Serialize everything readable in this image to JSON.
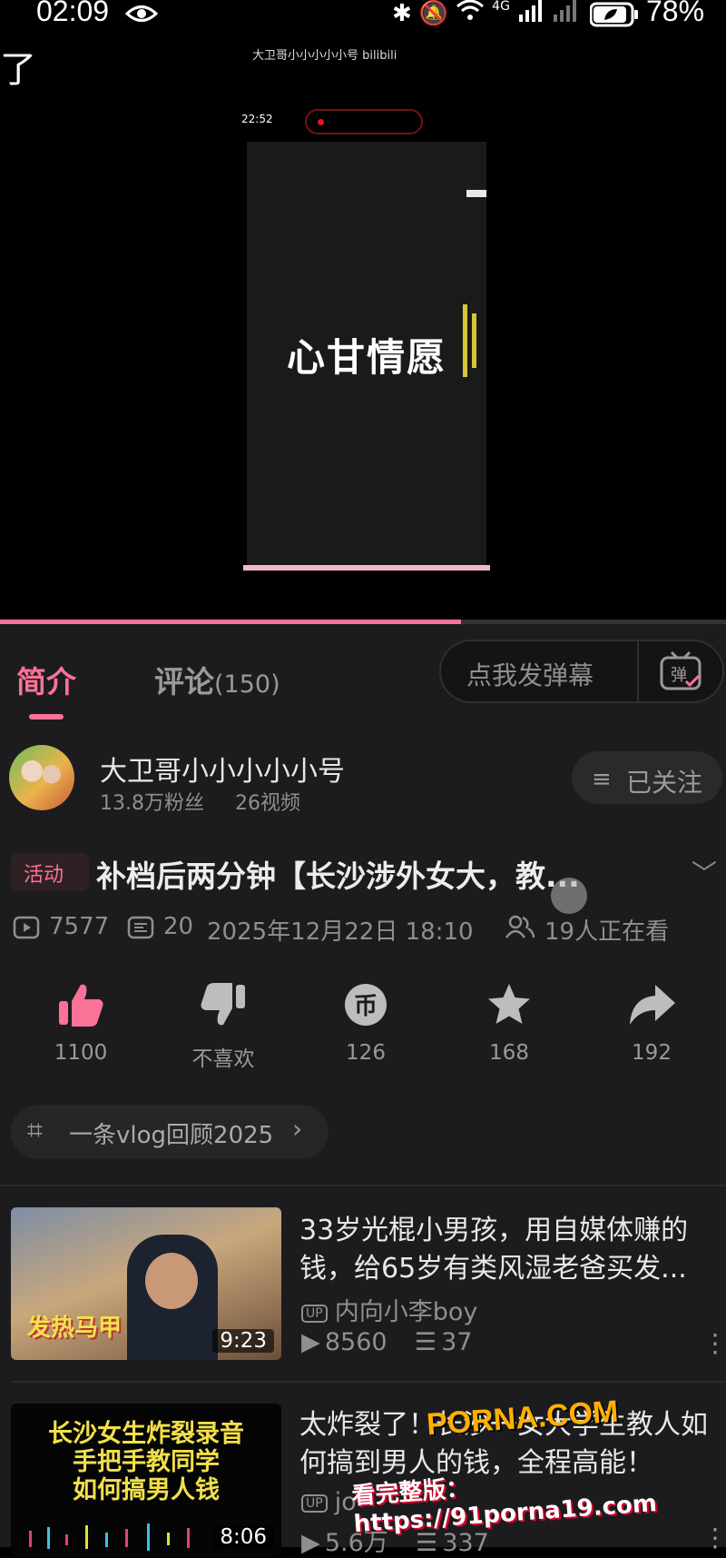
{
  "status_bar": {
    "time": "02:09",
    "battery": "78%",
    "network": "4G"
  },
  "video": {
    "left_text": "了",
    "watermark": "大卫哥小小小小小号 bilibili",
    "inner_time": "22:52",
    "frame_text": "心甘情愿",
    "progress_fraction": 0.635
  },
  "tabs": {
    "intro": "简介",
    "comments": "评论",
    "comments_count": "(150)"
  },
  "danmaku": {
    "placeholder": "点我发弹幕",
    "button": "弹"
  },
  "uploader": {
    "name": "大卫哥小小小小小号",
    "fans": "13.8万粉丝",
    "videos": "26视频",
    "follow_label": "已关注"
  },
  "video_info": {
    "tag": "活动",
    "title": "补档后两分钟【长沙涉外女大，教...",
    "views": "7577",
    "danmaku_count": "20",
    "date": "2025年12月22日 18:10",
    "watching": "19人正在看"
  },
  "actions": [
    {
      "name": "like",
      "label": "1100"
    },
    {
      "name": "dislike",
      "label": "不喜欢"
    },
    {
      "name": "coin",
      "label": "126"
    },
    {
      "name": "favorite",
      "label": "168"
    },
    {
      "name": "share",
      "label": "192"
    }
  ],
  "topic": "一条vlog回顾2025",
  "recommendations": [
    {
      "title": "33岁光棍小男孩，用自媒体赚的钱，给65岁有类风湿老爸买发...",
      "uploader": "内向小李boy",
      "views": "8560",
      "danmaku": "37",
      "duration": "9:23",
      "thumb_text": "发热马甲"
    },
    {
      "title": "太炸裂了！长沙一女大学生教人如何搞到男人的钱，全程高能！",
      "uploader": "jo",
      "views": "5.6万",
      "danmaku": "337",
      "duration": "8:06",
      "thumb_text": "长沙女生炸裂录音\n手把手教同学\n如何搞男人钱"
    }
  ],
  "overlay_watermark": {
    "line1": "PORNA.COM",
    "line2": "看完整版：https://91porna19.com"
  },
  "colors": {
    "accent": "#fb7299",
    "panel": "#1c1c1e"
  }
}
